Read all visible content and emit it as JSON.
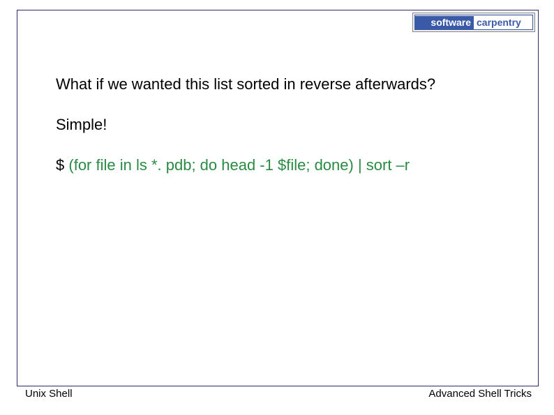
{
  "logo": {
    "software": "software",
    "carpentry": "carpentry"
  },
  "content": {
    "question": "What if we wanted this list sorted in reverse afterwards?",
    "answer": "Simple!",
    "prompt": "$",
    "command": "(for file in ls *. pdb; do head -1 $file; done) | sort –r"
  },
  "footer": {
    "left": "Unix Shell",
    "right": "Advanced Shell Tricks"
  }
}
